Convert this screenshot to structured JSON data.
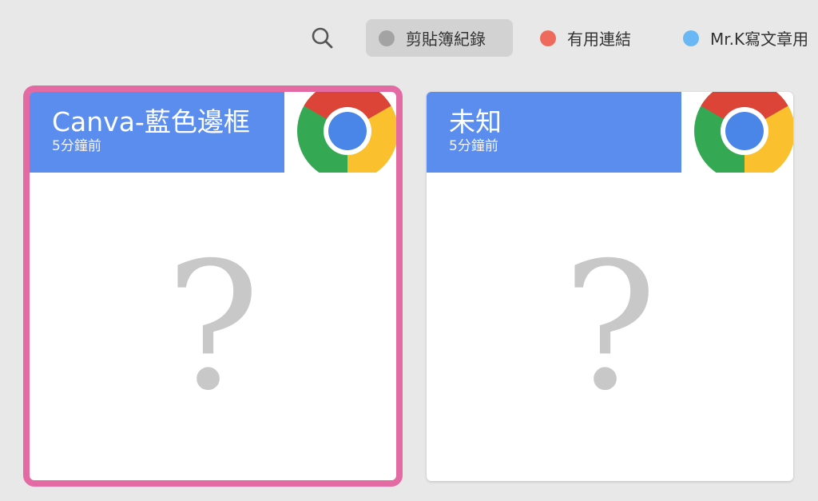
{
  "toolbar": {
    "search_icon": "search-icon",
    "tags": [
      {
        "label": "剪貼簿紀錄",
        "color": "#a3a3a3"
      },
      {
        "label": "有用連結",
        "color": "#ee6a5c"
      },
      {
        "label": "Mr.K寫文章用",
        "color": "#69b8f5"
      }
    ]
  },
  "colors": {
    "header_blue": "#5b8dee",
    "selection_pink": "#e36aa3"
  },
  "cards": [
    {
      "title": "Canva-藍色邊框",
      "time": "5分鐘前",
      "app_icon": "chrome-icon",
      "preview": "?"
    },
    {
      "title": "未知",
      "time": "5分鐘前",
      "app_icon": "chrome-icon",
      "preview": "?"
    }
  ]
}
